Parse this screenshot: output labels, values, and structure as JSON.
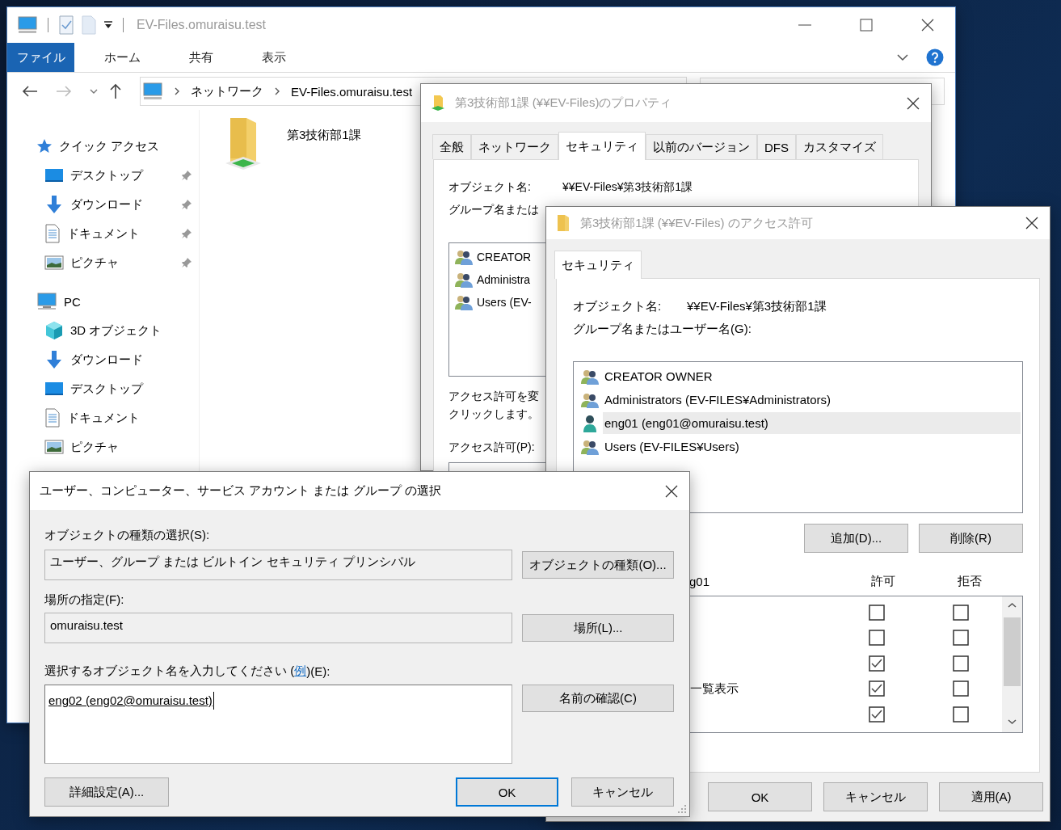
{
  "explorer": {
    "title": "EV-Files.omuraisu.test",
    "ribbon_tabs": [
      {
        "label": "ファイル",
        "selected": true
      },
      {
        "label": "ホーム",
        "selected": false
      },
      {
        "label": "共有",
        "selected": false
      },
      {
        "label": "表示",
        "selected": false
      }
    ],
    "breadcrumb": [
      "ネットワーク",
      "EV-Files.omuraisu.test"
    ],
    "nav": [
      {
        "kind": "star",
        "label": "クイック アクセス",
        "children": [
          {
            "kind": "desktop",
            "label": "デスクトップ",
            "pinned": true
          },
          {
            "kind": "download",
            "label": "ダウンロード",
            "pinned": true
          },
          {
            "kind": "document",
            "label": "ドキュメント",
            "pinned": true
          },
          {
            "kind": "picture",
            "label": "ピクチャ",
            "pinned": true
          }
        ]
      },
      {
        "kind": "pc",
        "label": "PC",
        "children": [
          {
            "kind": "cube",
            "label": "3D オブジェクト",
            "pinned": false
          },
          {
            "kind": "download",
            "label": "ダウンロード",
            "pinned": false
          },
          {
            "kind": "desktop",
            "label": "デスクトップ",
            "pinned": false
          },
          {
            "kind": "document",
            "label": "ドキュメント",
            "pinned": false
          },
          {
            "kind": "picture",
            "label": "ピクチャ",
            "pinned": false
          }
        ]
      }
    ],
    "files": [
      {
        "name": "第3技術部1課"
      }
    ]
  },
  "properties": {
    "title": "第3技術部1課 (¥¥EV-Files)のプロパティ",
    "tabs": [
      {
        "label": "全般",
        "selected": false
      },
      {
        "label": "ネットワーク",
        "selected": false
      },
      {
        "label": "セキュリティ",
        "selected": true
      },
      {
        "label": "以前のバージョン",
        "selected": false
      },
      {
        "label": "DFS",
        "selected": false
      },
      {
        "label": "カスタマイズ",
        "selected": false
      }
    ],
    "object_label": "オブジェクト名:",
    "object_value": "¥¥EV-Files¥第3技術部1課",
    "group_label": "グループ名または",
    "principals": [
      "CREATOR",
      "Administra",
      "Users (EV-"
    ],
    "note": [
      "アクセス許可を変",
      "クリックします。"
    ],
    "permissions_label": "アクセス許可(P):"
  },
  "access_permissions": {
    "title": "第3技術部1課 (¥¥EV-Files) のアクセス許可",
    "tab": "セキュリティ",
    "object_label": "オブジェクト名:",
    "object_value": "¥¥EV-Files¥第3技術部1課",
    "group_label": "グループ名またはユーザー名(G):",
    "principals": [
      {
        "kind": "group",
        "name": "CREATOR OWNER",
        "selected": false
      },
      {
        "kind": "group",
        "name": "Administrators (EV-FILES¥Administrators)",
        "selected": false
      },
      {
        "kind": "user",
        "name": "eng01 (eng01@omuraisu.test)",
        "selected": true
      },
      {
        "kind": "group",
        "name": "Users (EV-FILES¥Users)",
        "selected": false
      }
    ],
    "add_button": "追加(D)...",
    "remove_button": "削除(R)",
    "permissions_header": "g01",
    "allow_header": "許可",
    "deny_header": "拒否",
    "permissions": [
      {
        "allow": false,
        "deny": false
      },
      {
        "allow": false,
        "deny": false
      },
      {
        "allow": true,
        "deny": false
      },
      {
        "label": "一覧表示",
        "allow": true,
        "deny": false
      },
      {
        "allow": true,
        "deny": false
      }
    ],
    "buttons": [
      "OK",
      "キャンセル",
      "適用(A)"
    ]
  },
  "select_dialog": {
    "title": "ユーザー、コンピューター、サービス アカウント または グループ の選択",
    "object_types_label": "オブジェクトの種類の選択(S):",
    "object_types_value": "ユーザー、グループ または ビルトイン セキュリティ プリンシパル",
    "object_types_button": "オブジェクトの種類(O)...",
    "location_label": "場所の指定(F):",
    "location_value": "omuraisu.test",
    "location_button": "場所(L)...",
    "names_prompt": {
      "before": "選択するオブジェクト名を入力してください (",
      "link": "例",
      "after": ")(E):"
    },
    "names_value": "eng02 (eng02@omuraisu.test)",
    "check_names_button": "名前の確認(C)",
    "advanced_button": "詳細設定(A)...",
    "ok_button": "OK",
    "cancel_button": "キャンセル"
  }
}
